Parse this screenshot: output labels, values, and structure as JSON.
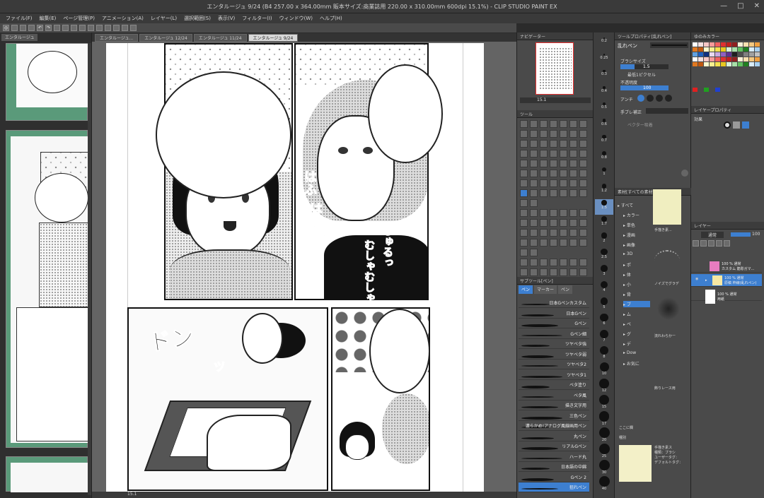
{
  "window": {
    "title": "エンタルージュ 9/24 (B4 257.00 x 364.00mm 販本サイズ:商業誌用 220.00 x 310.00mm 600dpi 15.1%) - CLIP STUDIO PAINT EX",
    "min": "—",
    "max": "□",
    "close": "✕"
  },
  "menu": [
    "ファイル(F)",
    "編集(E)",
    "ページ管理(P)",
    "アニメーション(A)",
    "レイヤー(L)",
    "選択範囲(S)",
    "表示(V)",
    "フィルター(I)",
    "ウィンドウ(W)",
    "ヘルプ(H)"
  ],
  "tabs": [
    "エンタルージュ...",
    "エンタルージュ 12/24",
    "エンタルージュ 11/24",
    "エンタルージュ 9/24"
  ],
  "left_panel": {
    "tab": "エンタルージュ"
  },
  "canvas": {
    "sfx": {
      "hafu1": "はふ",
      "hafu2": "はふ",
      "hafu3": "ふ",
      "jurutsu": "じゅるっ",
      "mushamusha": "むしゃむしゃ",
      "dodon": "ドン",
      "dodon_tail": "ッ"
    }
  },
  "status": {
    "zoom": "15.1"
  },
  "navigator": {
    "title": "ナビゲーター",
    "zoom": "15.1"
  },
  "tool": {
    "title": "ツール"
  },
  "sub_tool": {
    "title": "サブツール[ペン]",
    "tabs": [
      "ペン",
      "マーカー",
      "ペン"
    ],
    "brushes": [
      "日本Gペンカスタム",
      "日本Gペン",
      "Gペン",
      "Gペン細",
      "ツヤベタ強",
      "ツヤベタ弱",
      "ツヤベタ2",
      "ツヤベタ1",
      "ベタ塗り",
      "ベタ風",
      "描き文字用",
      "三色ペン",
      "濃らかめ!アナログ風線画用ペン",
      "丸ペン",
      "リアルGペン",
      "ハード丸",
      "日本語の中綿",
      "Gペン 2",
      "狙れペン"
    ]
  },
  "brush_sizes": [
    "0.2",
    "0.25",
    "0.3",
    "0.4",
    "0.5",
    "0.6",
    "0.7",
    "0.8",
    "1",
    "1.2",
    "1.5",
    "1.7",
    "2",
    "2.5",
    "3",
    "4",
    "5",
    "6",
    "7",
    "8",
    "10",
    "12",
    "15",
    "17",
    "20",
    "25",
    "30",
    "40"
  ],
  "tool_property": {
    "title": "ツールプロパティ[乱れペン]",
    "tool_name": "乱れペン",
    "brush_size_label": "ブラシサイズ",
    "brush_size_value": "1.5",
    "min_width_label": "最低1ピクセル",
    "opacity_label": "不透明度",
    "opacity_value": "100",
    "antialias_label": "アンチ",
    "stabilize_label": "手ブレ補正",
    "vector_label": "ベクター吸着"
  },
  "color_set": {
    "title": "ゆのみカラー"
  },
  "layer_property": {
    "title": "レイヤープロパティ",
    "effect_label": "効果"
  },
  "material": {
    "title": "素材[すべての素材]",
    "tree": [
      "すべて",
      "カラー",
      "単色",
      "漫画",
      "画像",
      "3D",
      "ポ",
      "体",
      "小",
      "背",
      "ブ",
      "ム",
      "ペ",
      "グ",
      "デ",
      "Dow",
      "お気に"
    ],
    "items": [
      "手描き素...",
      "ノイズでグラデ",
      "流れわらかー",
      "飾りレース用"
    ],
    "search_label": "ここに欄",
    "kind_label": "種別",
    "detail": [
      "手描き素ス",
      "種類：ブラシ",
      "ユーザータグ：",
      "デフォルトタグ："
    ]
  },
  "layer_panel": {
    "title": "レイヤー",
    "blend": "通常",
    "opacity": "100",
    "layers": [
      {
        "name": "100 % 通常",
        "sub": "カスタム 筋彫ガマ..."
      },
      {
        "name": "100 % 通常",
        "sub": "原稿 枠線(乱れペン)"
      },
      {
        "name": "100 % 通常",
        "sub": ""
      },
      {
        "name": "用紙",
        "sub": ""
      }
    ]
  },
  "colors": {
    "accent": "#3d7fd0",
    "panel_bg": "#4a4a4a",
    "title_bg": "#3a3a3a",
    "canvas_bg": "#646464",
    "thumb_green": "#5a9a7a"
  }
}
